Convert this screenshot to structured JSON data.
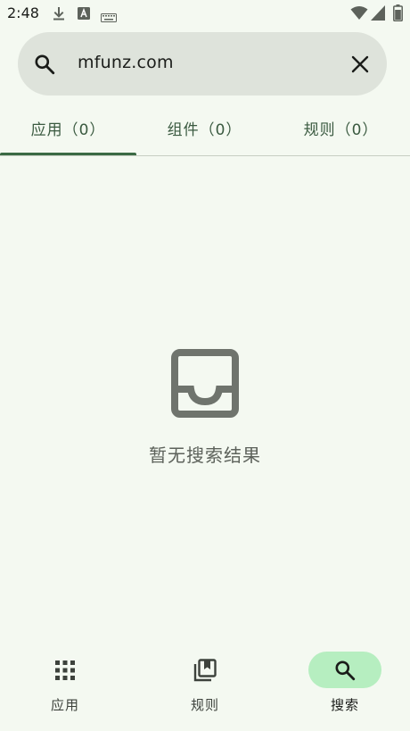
{
  "status_bar": {
    "time": "2:48"
  },
  "search": {
    "query": "mfunz.com"
  },
  "tabs": [
    {
      "label": "应用（0）",
      "selected": true
    },
    {
      "label": "组件（0）",
      "selected": false
    },
    {
      "label": "规则（0）",
      "selected": false
    }
  ],
  "empty_state": {
    "message": "暂无搜索结果",
    "icon": "inbox-icon"
  },
  "bottom_nav": [
    {
      "label": "应用",
      "icon": "apps-grid-icon",
      "selected": false
    },
    {
      "label": "规则",
      "icon": "bookmarks-icon",
      "selected": false
    },
    {
      "label": "搜索",
      "icon": "search-icon",
      "selected": true
    }
  ],
  "colors": {
    "accent": "#3b6a44",
    "background": "#f4f9f1",
    "active_pill": "#b6eec0"
  }
}
